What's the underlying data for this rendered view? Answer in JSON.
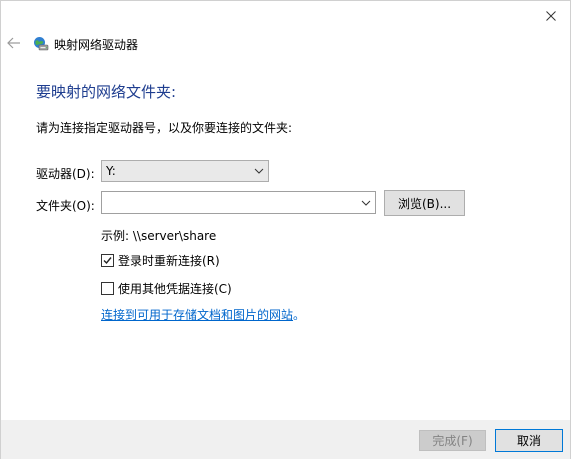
{
  "window": {
    "title": "映射网络驱动器"
  },
  "main": {
    "heading": "要映射的网络文件夹:",
    "instruction": "请为连接指定驱动器号，以及你要连接的文件夹:",
    "drive_label": "驱动器(D):",
    "drive_value": "Y:",
    "folder_label": "文件夹(O):",
    "folder_value": "",
    "browse_label": "浏览(B)...",
    "example": "示例: \\\\server\\share",
    "reconnect_label": "登录时重新连接(R)",
    "reconnect_checked": true,
    "other_creds_label": "使用其他凭据连接(C)",
    "other_creds_checked": false,
    "link_text": "连接到可用于存储文档和图片的网站",
    "link_suffix": "。"
  },
  "footer": {
    "finish_label": "完成(F)",
    "cancel_label": "取消"
  },
  "colors": {
    "heading": "#1e3d8f",
    "link": "#0066cc",
    "focus_border": "#0078d7",
    "footer_bg": "#f0f0f0"
  },
  "icons": [
    "close-icon",
    "back-arrow-icon",
    "network-drive-icon",
    "chevron-down-icon",
    "checkmark-icon"
  ]
}
